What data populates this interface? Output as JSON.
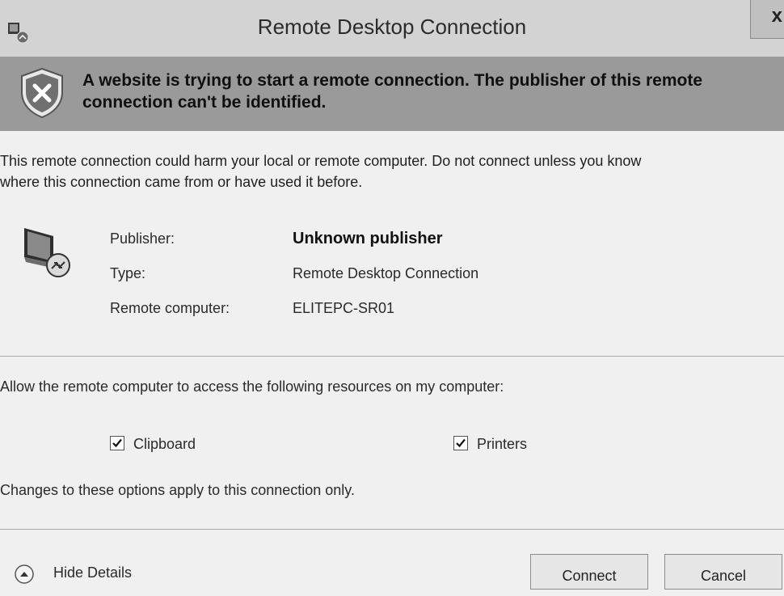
{
  "window": {
    "title": "Remote Desktop Connection",
    "close_label": "x"
  },
  "banner": {
    "text": "A website is trying to start a remote connection. The publisher of this remote\nconnection can't be identified."
  },
  "warning": {
    "text": "This remote connection could harm your local or remote computer. Do not connect unless you know\nwhere this connection came from or have used it before."
  },
  "details": {
    "publisher_label": "Publisher:",
    "publisher_value": "Unknown publisher",
    "type_label": "Type:",
    "type_value": "Remote Desktop Connection",
    "remote_label": "Remote computer:",
    "remote_value": "ELITEPC-SR01"
  },
  "resources": {
    "allow_text": "Allow the remote computer to access the following resources on my computer:",
    "clipboard_label": "Clipboard",
    "clipboard_checked": true,
    "printers_label": "Printers",
    "printers_checked": true,
    "changes_text": "Changes to these options apply to this connection only."
  },
  "footer": {
    "hide_details_label": "Hide Details",
    "connect_label": "Connect",
    "cancel_label": "Cancel"
  },
  "icons": {
    "app": "remote-desktop-icon",
    "shield": "shield-x-icon",
    "computer": "computer-icon",
    "check": "check-icon",
    "hide": "chevron-up-circle-icon"
  }
}
